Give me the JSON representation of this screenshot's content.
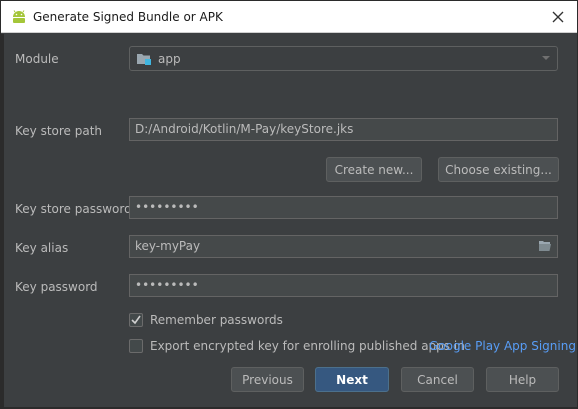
{
  "window": {
    "title": "Generate Signed Bundle or APK",
    "close_symbol": "✕"
  },
  "module": {
    "label": "Module",
    "value": "app"
  },
  "key_store_path": {
    "label": "Key store path",
    "value": "D:/Android/Kotlin/M-Pay/keyStore.jks"
  },
  "keystore_buttons": {
    "create_new": "Create new...",
    "choose_existing": "Choose existing..."
  },
  "key_store_password": {
    "label": "Key store password",
    "value": "•••••••••"
  },
  "key_alias": {
    "label": "Key alias",
    "value": "key-myPay"
  },
  "key_password": {
    "label": "Key password",
    "value": "•••••••••"
  },
  "remember_passwords": {
    "label": "Remember passwords",
    "checked": true
  },
  "export_key": {
    "label": "Export encrypted key for enrolling published apps in",
    "link": "Google Play App Signing",
    "checked": false
  },
  "footer": {
    "previous": "Previous",
    "next": "Next",
    "cancel": "Cancel",
    "help": "Help"
  },
  "colors": {
    "background": "#3c3f41",
    "field": "#45494a",
    "primary": "#365880",
    "link": "#589df6",
    "android_green": "#a4c639"
  },
  "icons": {
    "title": "android-icon",
    "module": "folder-icon",
    "alias": "folder-open-icon"
  }
}
